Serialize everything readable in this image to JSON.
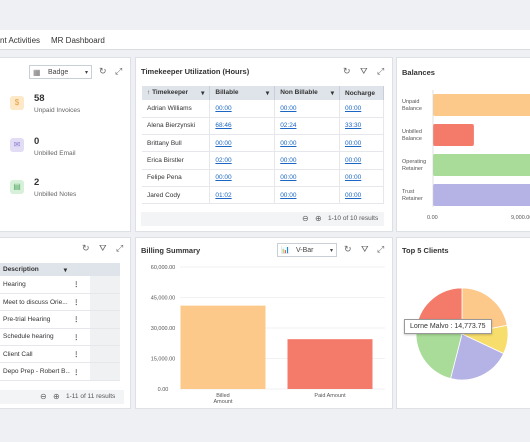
{
  "nav": {
    "tabs": [
      "nt Activities",
      "MR Dashboard"
    ]
  },
  "left_panel": {
    "dropdown": "Badge",
    "stats": [
      {
        "value": "58",
        "label": "Unpaid Invoices",
        "icon": "dollar-icon",
        "color": "#fde8c8",
        "glyph": "$"
      },
      {
        "value": "0",
        "label": "Unbilled Email",
        "icon": "mail-icon",
        "color": "#e2dcf5",
        "glyph": "✉"
      },
      {
        "value": "2",
        "label": "Unbilled Notes",
        "icon": "note-icon",
        "color": "#d6f0d9",
        "glyph": "▤"
      }
    ]
  },
  "timekeeper": {
    "title": "Timekeeper Utilization (Hours)",
    "headers": [
      "Timekeeper",
      "Billable",
      "Non Billable",
      "Nocharge"
    ],
    "rows": [
      [
        "Adrian Williams",
        "00:00",
        "00:00",
        "00:00"
      ],
      [
        "Alena Bierzynski",
        "68:46",
        "02:24",
        "33:30"
      ],
      [
        "Brittany Bull",
        "00:00",
        "00:00",
        "00:00"
      ],
      [
        "Erica Birstler",
        "02:00",
        "00:00",
        "00:00"
      ],
      [
        "Felipe Pena",
        "00:00",
        "00:00",
        "00:00"
      ],
      [
        "Jared Cody",
        "01:02",
        "00:00",
        "00:00"
      ]
    ],
    "pager": "1-10 of 10 results"
  },
  "balances": {
    "title": "Balances",
    "chart_data": {
      "type": "bar",
      "orientation": "horizontal",
      "categories": [
        "Unpaid Balance",
        "Unbilled Balance",
        "Operating Retainer",
        "Trust Retainer"
      ],
      "category_lines": [
        [
          "Unpaid",
          "Balance"
        ],
        [
          "Unbilled",
          "Balance"
        ],
        [
          "Operating",
          "Retainer"
        ],
        [
          "Trust",
          "Retainer"
        ]
      ],
      "values": [
        14000,
        4000,
        13000,
        15000
      ],
      "colors": [
        "#fdc98a",
        "#f47a6a",
        "#a8dc98",
        "#b5b2e6"
      ],
      "xticks": [
        "0.00",
        "9,000.00"
      ]
    }
  },
  "description": {
    "header": "Description",
    "rows": [
      "Hearing",
      "Meet to discuss Orie...",
      "Pre-trial Hearing",
      "Schedule hearing",
      "Client Call",
      "Depo Prep - Robert B..."
    ],
    "pager": "1-11 of 11 results"
  },
  "billing": {
    "title": "Billing Summary",
    "dropdown": "V-Bar",
    "chart_data": {
      "type": "bar",
      "categories": [
        "Billed Amount",
        "Paid Amount"
      ],
      "category_lines": [
        [
          "Billed",
          "Amount"
        ],
        [
          "Paid Amount"
        ]
      ],
      "values": [
        41000,
        24500
      ],
      "colors": [
        "#fdc98a",
        "#f47a6a"
      ],
      "yticks": [
        "0.00",
        "15,000.00",
        "30,000.00",
        "45,000.00",
        "60,000.00"
      ],
      "ylim": [
        0,
        60000
      ]
    }
  },
  "top5": {
    "title": "Top 5 Clients",
    "tooltip": "Lorne Malvo : 14,773.75",
    "chart_data": {
      "type": "pie",
      "slices": [
        {
          "value": 22,
          "color": "#fdc98a"
        },
        {
          "value": 10,
          "color": "#f7dd6b"
        },
        {
          "value": 22,
          "color": "#b5b2e6"
        },
        {
          "value": 24,
          "color": "#a8dc98"
        },
        {
          "value": 22,
          "color": "#f47a6a"
        }
      ]
    }
  }
}
